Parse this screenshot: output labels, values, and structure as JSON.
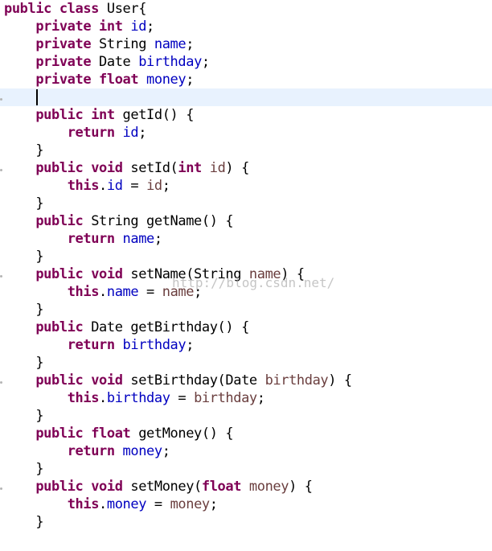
{
  "editor": {
    "current_line": 5,
    "lines": [
      [
        [
          "kw",
          "public class "
        ],
        [
          "t",
          "User{"
        ]
      ],
      [
        [
          "t",
          "    "
        ],
        [
          "kw",
          "private int "
        ],
        [
          "fld",
          "id"
        ],
        [
          "t",
          ";"
        ]
      ],
      [
        [
          "t",
          "    "
        ],
        [
          "kw",
          "private "
        ],
        [
          "t",
          "String "
        ],
        [
          "fld",
          "name"
        ],
        [
          "t",
          ";"
        ]
      ],
      [
        [
          "t",
          "    "
        ],
        [
          "kw",
          "private "
        ],
        [
          "t",
          "Date "
        ],
        [
          "fld",
          "birthday"
        ],
        [
          "t",
          ";"
        ]
      ],
      [
        [
          "t",
          "    "
        ],
        [
          "kw",
          "private float "
        ],
        [
          "fld",
          "money"
        ],
        [
          "t",
          ";"
        ]
      ],
      [
        [
          "t",
          "    "
        ]
      ],
      [
        [
          "t",
          "    "
        ],
        [
          "kw",
          "public int "
        ],
        [
          "t",
          "getId() {"
        ]
      ],
      [
        [
          "t",
          "        "
        ],
        [
          "kw",
          "return "
        ],
        [
          "fld",
          "id"
        ],
        [
          "t",
          ";"
        ]
      ],
      [
        [
          "t",
          "    }"
        ]
      ],
      [
        [
          "t",
          "    "
        ],
        [
          "kw",
          "public void "
        ],
        [
          "t",
          "setId("
        ],
        [
          "kw",
          "int "
        ],
        [
          "prm",
          "id"
        ],
        [
          "t",
          ") {"
        ]
      ],
      [
        [
          "t",
          "        "
        ],
        [
          "kw",
          "this"
        ],
        [
          "t",
          "."
        ],
        [
          "fld",
          "id"
        ],
        [
          "t",
          " = "
        ],
        [
          "prm",
          "id"
        ],
        [
          "t",
          ";"
        ]
      ],
      [
        [
          "t",
          "    }"
        ]
      ],
      [
        [
          "t",
          "    "
        ],
        [
          "kw",
          "public "
        ],
        [
          "t",
          "String getName() {"
        ]
      ],
      [
        [
          "t",
          "        "
        ],
        [
          "kw",
          "return "
        ],
        [
          "fld",
          "name"
        ],
        [
          "t",
          ";"
        ]
      ],
      [
        [
          "t",
          "    }"
        ]
      ],
      [
        [
          "t",
          "    "
        ],
        [
          "kw",
          "public void "
        ],
        [
          "t",
          "setName(String "
        ],
        [
          "prm",
          "name"
        ],
        [
          "t",
          ") {"
        ]
      ],
      [
        [
          "t",
          "        "
        ],
        [
          "kw",
          "this"
        ],
        [
          "t",
          "."
        ],
        [
          "fld",
          "name"
        ],
        [
          "t",
          " = "
        ],
        [
          "prm",
          "name"
        ],
        [
          "t",
          ";"
        ]
      ],
      [
        [
          "t",
          "    }"
        ]
      ],
      [
        [
          "t",
          "    "
        ],
        [
          "kw",
          "public "
        ],
        [
          "t",
          "Date getBirthday() {"
        ]
      ],
      [
        [
          "t",
          "        "
        ],
        [
          "kw",
          "return "
        ],
        [
          "fld",
          "birthday"
        ],
        [
          "t",
          ";"
        ]
      ],
      [
        [
          "t",
          "    }"
        ]
      ],
      [
        [
          "t",
          "    "
        ],
        [
          "kw",
          "public void "
        ],
        [
          "t",
          "setBirthday(Date "
        ],
        [
          "prm",
          "birthday"
        ],
        [
          "t",
          ") {"
        ]
      ],
      [
        [
          "t",
          "        "
        ],
        [
          "kw",
          "this"
        ],
        [
          "t",
          "."
        ],
        [
          "fld",
          "birthday"
        ],
        [
          "t",
          " = "
        ],
        [
          "prm",
          "birthday"
        ],
        [
          "t",
          ";"
        ]
      ],
      [
        [
          "t",
          "    }"
        ]
      ],
      [
        [
          "t",
          "    "
        ],
        [
          "kw",
          "public float "
        ],
        [
          "t",
          "getMoney() {"
        ]
      ],
      [
        [
          "t",
          "        "
        ],
        [
          "kw",
          "return "
        ],
        [
          "fld",
          "money"
        ],
        [
          "t",
          ";"
        ]
      ],
      [
        [
          "t",
          "    }"
        ]
      ],
      [
        [
          "t",
          "    "
        ],
        [
          "kw",
          "public void "
        ],
        [
          "t",
          "setMoney("
        ],
        [
          "kw",
          "float "
        ],
        [
          "prm",
          "money"
        ],
        [
          "t",
          ") {"
        ]
      ],
      [
        [
          "t",
          "        "
        ],
        [
          "kw",
          "this"
        ],
        [
          "t",
          "."
        ],
        [
          "fld",
          "money"
        ],
        [
          "t",
          " = "
        ],
        [
          "prm",
          "money"
        ],
        [
          "t",
          ";"
        ]
      ],
      [
        [
          "t",
          "    }"
        ]
      ]
    ],
    "marker_lines": [
      5,
      9,
      15,
      21,
      27
    ]
  },
  "watermark": {
    "text": "http://blog.csdn.net/"
  },
  "colors": {
    "keyword": "#7f0055",
    "field": "#0000c0",
    "parameter": "#6a3e3e",
    "current_line_bg": "#e8f2fe"
  }
}
